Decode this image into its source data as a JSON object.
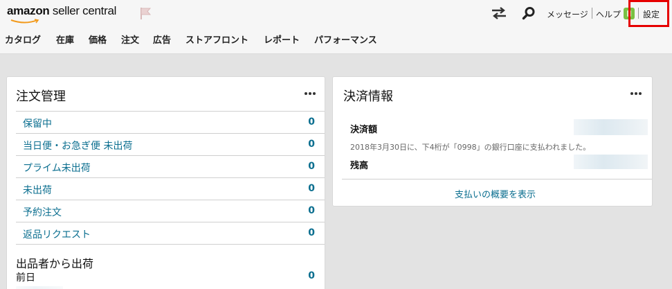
{
  "header": {
    "logo_amazon": "amazon",
    "logo_rest": " seller central",
    "top_links": [
      "メッセージ",
      "ヘルプ",
      "設定"
    ]
  },
  "nav": {
    "items": [
      "カタログ",
      "在庫",
      "価格",
      "注文",
      "広告",
      "ストアフロント",
      "レポート",
      "パフォーマンス"
    ]
  },
  "order_card": {
    "title": "注文管理",
    "rows": [
      {
        "label": "保留中",
        "value": "0"
      },
      {
        "label": "当日便・お急ぎ便 未出荷",
        "value": "0"
      },
      {
        "label": "プライム未出荷",
        "value": "0"
      },
      {
        "label": "未出荷",
        "value": "0"
      },
      {
        "label": "予約注文",
        "value": "0"
      },
      {
        "label": "返品リクエスト",
        "value": "0"
      }
    ],
    "seller_shipping_title": "出品者から出荷",
    "seller_rows": [
      {
        "label": "前日",
        "value": "0"
      }
    ]
  },
  "payment_card": {
    "title": "決済情報",
    "settlement_label": "決済額",
    "settlement_note": "2018年3月30日に、下4桁が「0998」の銀行口座に支払われました。",
    "balance_label": "残高",
    "summary_link": "支払いの概要を表示"
  },
  "colors": {
    "link": "#0a6e8f",
    "highlight": "#e60000",
    "badge": "#7ac143"
  },
  "icons": [
    "flag-icon",
    "swap-arrows-icon",
    "search-icon",
    "badge-icon",
    "more-options-icon"
  ]
}
